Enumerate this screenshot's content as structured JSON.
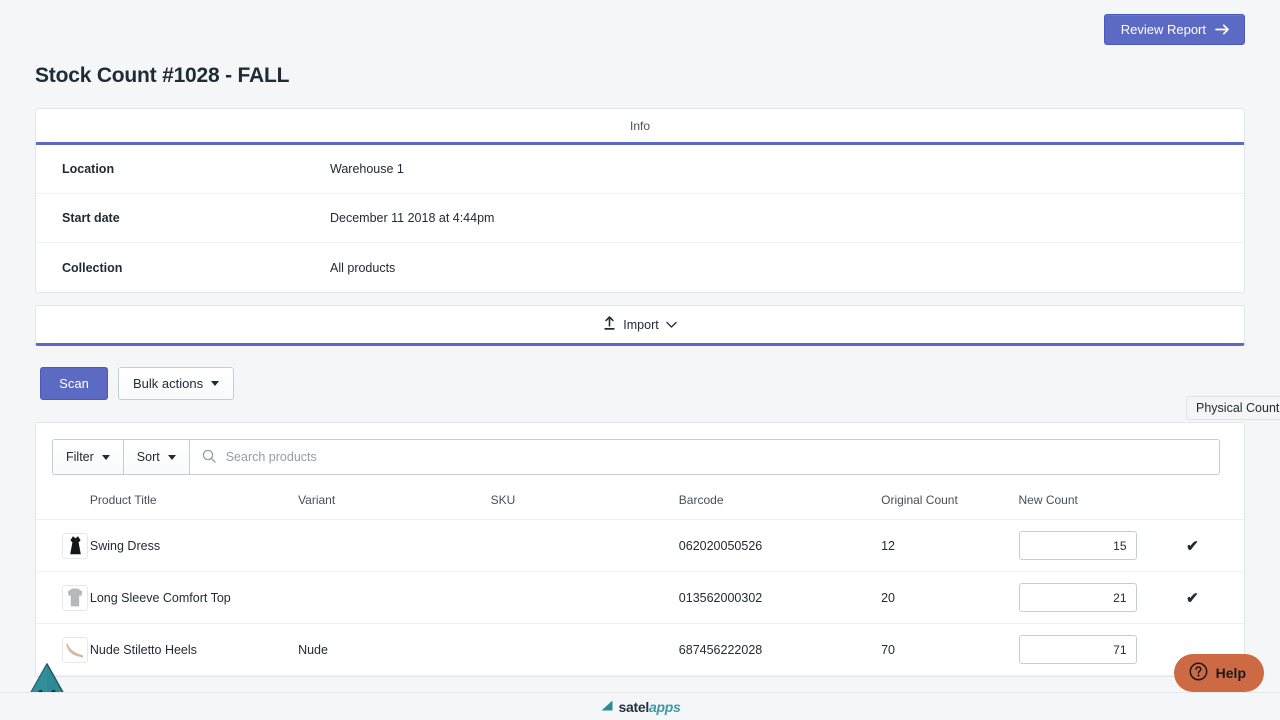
{
  "header": {
    "review_button": "Review Report",
    "review_icon": "arrow-right-icon"
  },
  "page": {
    "title": "Stock Count #1028 - FALL"
  },
  "info_card": {
    "heading": "Info",
    "rows": [
      {
        "label": "Location",
        "value": "Warehouse 1"
      },
      {
        "label": "Start date",
        "value": "December 11 2018 at 4:44pm"
      },
      {
        "label": "Collection",
        "value": "All products"
      }
    ]
  },
  "import_card": {
    "label": "Import",
    "icon": "upload-icon",
    "chevron": "chevron-down-icon"
  },
  "actions": {
    "scan_label": "Scan",
    "bulk_actions_label": "Bulk actions"
  },
  "tooltip": {
    "physical_count": "Physical Count"
  },
  "filter_bar": {
    "filter_label": "Filter",
    "sort_label": "Sort",
    "search_placeholder": "Search products",
    "search_value": "",
    "search_icon": "search-icon"
  },
  "table": {
    "columns": [
      "Product Title",
      "Variant",
      "SKU",
      "Barcode",
      "Original Count",
      "New Count"
    ],
    "rows": [
      {
        "thumb": "black-dress-thumbnail",
        "title": "Swing Dress",
        "variant": "",
        "sku": "",
        "barcode": "062020050526",
        "original_count": "12",
        "new_count": "15",
        "confirmed": "✔"
      },
      {
        "thumb": "gray-long-sleeve-top-thumbnail",
        "title": "Long Sleeve Comfort Top",
        "variant": "",
        "sku": "",
        "barcode": "013562000302",
        "original_count": "20",
        "new_count": "21",
        "confirmed": "✔"
      },
      {
        "thumb": "nude-stiletto-heel-thumbnail",
        "title": "Nude Stiletto Heels",
        "variant": "Nude",
        "sku": "",
        "barcode": "687456222028",
        "original_count": "70",
        "new_count": "71",
        "confirmed": ""
      }
    ]
  },
  "help": {
    "label": "Help",
    "icon": "question-mark-circle-icon"
  },
  "footer": {
    "logo_primary": "satel",
    "logo_secondary": "apps",
    "logo_icon": "teal-triangle-logo-icon"
  },
  "colors": {
    "accent_indigo": "#5c6ac4",
    "page_background": "#f4f6f8",
    "teal": "#3b9aa6",
    "help_orange": "#cd6a43",
    "text": "#212b36"
  }
}
